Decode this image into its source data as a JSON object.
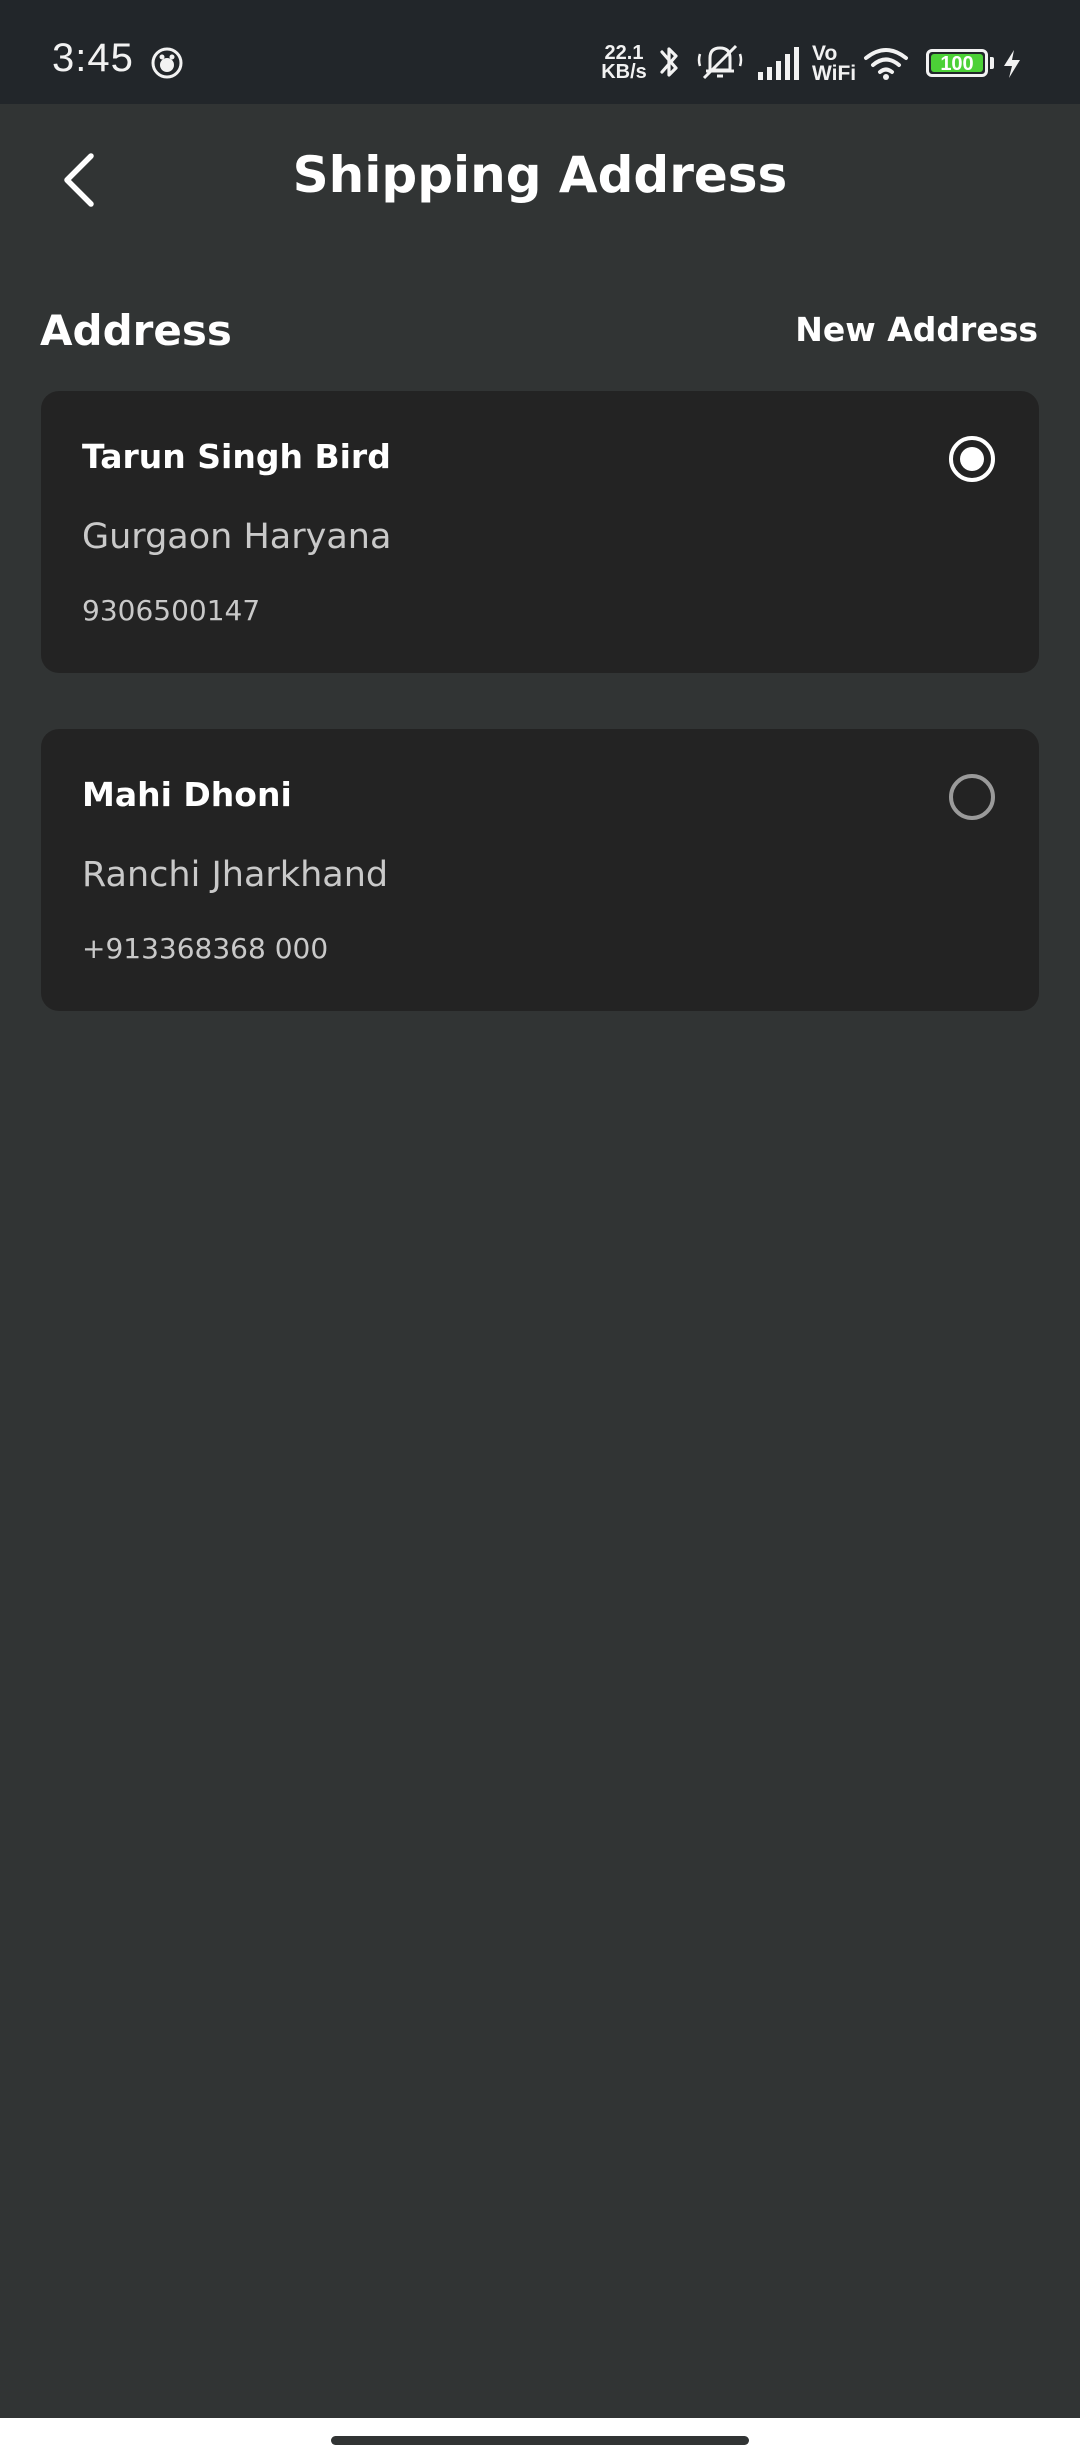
{
  "status_bar": {
    "time": "3:45",
    "net_speed_value": "22.1",
    "net_speed_unit": "KB/s",
    "vowifi_top": "Vo",
    "vowifi_bottom": "WiFi",
    "battery_level": "100",
    "icons": [
      "notification-icon",
      "bluetooth-icon",
      "mute-icon",
      "signal-icon",
      "wifi-icon",
      "battery-icon",
      "charging-icon"
    ]
  },
  "header": {
    "title": "Shipping Address",
    "back_icon": "chevron-left-icon"
  },
  "section": {
    "title": "Address",
    "new_address_label": "New Address"
  },
  "addresses": [
    {
      "name": "Tarun Singh Bird",
      "location": "Gurgaon Haryana",
      "phone": "9306500147",
      "selected": true
    },
    {
      "name": "Mahi Dhoni",
      "location": "Ranchi Jharkhand",
      "phone": "+913368368 000",
      "selected": false
    }
  ],
  "colors": {
    "background": "#313434",
    "card": "#232323",
    "status_bar": "#22262a",
    "text_primary": "#ffffff",
    "text_secondary": "#c9c9c9",
    "battery": "#4cd137"
  }
}
